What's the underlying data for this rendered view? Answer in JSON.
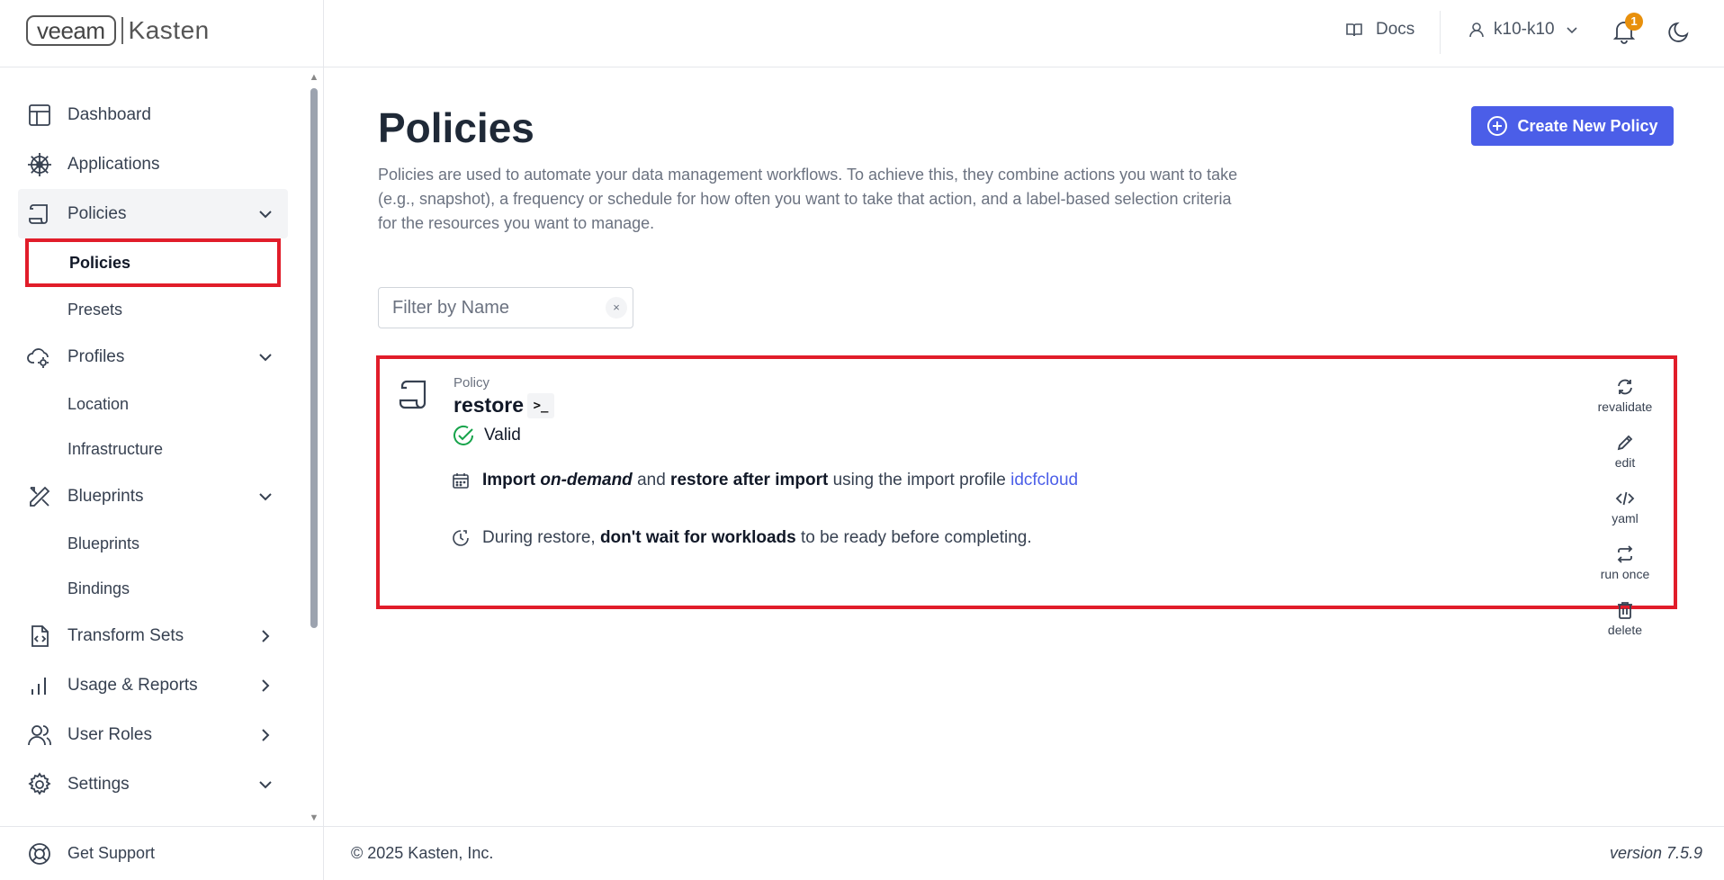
{
  "brand": {
    "logo_left": "veeam",
    "logo_right": "Kasten"
  },
  "topbar": {
    "docs_label": "Docs",
    "user_label": "k10-k10",
    "notification_count": "1"
  },
  "sidebar": {
    "items": [
      {
        "label": "Dashboard",
        "icon": "dashboard-icon"
      },
      {
        "label": "Applications",
        "icon": "helm-wheel-icon"
      },
      {
        "label": "Policies",
        "icon": "scroll-icon",
        "expanded": true,
        "children": [
          {
            "label": "Policies",
            "selected": true
          },
          {
            "label": "Presets"
          }
        ]
      },
      {
        "label": "Profiles",
        "icon": "cloud-gear-icon",
        "expanded": true,
        "children": [
          {
            "label": "Location"
          },
          {
            "label": "Infrastructure"
          }
        ]
      },
      {
        "label": "Blueprints",
        "icon": "pencil-ruler-icon",
        "expanded": true,
        "children": [
          {
            "label": "Blueprints"
          },
          {
            "label": "Bindings"
          }
        ]
      },
      {
        "label": "Transform Sets",
        "icon": "file-code-icon"
      },
      {
        "label": "Usage & Reports",
        "icon": "bar-chart-icon"
      },
      {
        "label": "User Roles",
        "icon": "users-icon"
      },
      {
        "label": "Settings",
        "icon": "gear-icon"
      }
    ],
    "support_label": "Get Support"
  },
  "main": {
    "title": "Policies",
    "create_button": "Create New Policy",
    "description": "Policies are used to automate your data management workflows. To achieve this, they combine actions you want to take (e.g., snapshot), a frequency or schedule for how often you want to take that action, and a label-based selection criteria for the resources you want to manage.",
    "filter_placeholder": "Filter by Name",
    "filter_clear": "×",
    "policy": {
      "kind": "Policy",
      "name": "restore",
      "terminal_label": ">_",
      "status": "Valid",
      "line1": {
        "w1": "Import",
        "w2": "on-demand",
        "w3": "and",
        "w4": "restore after import",
        "w5": "using the import profile",
        "profile": "idcfcloud"
      },
      "line2": {
        "w1": "During restore,",
        "w2": "don't wait for workloads",
        "w3": "to be ready before completing."
      },
      "actions": [
        {
          "label": "revalidate",
          "icon": "refresh-icon"
        },
        {
          "label": "edit",
          "icon": "pencil-icon"
        },
        {
          "label": "yaml",
          "icon": "code-icon"
        },
        {
          "label": "run once",
          "icon": "arrows-exchange-icon"
        },
        {
          "label": "delete",
          "icon": "trash-icon"
        }
      ]
    }
  },
  "footer": {
    "copyright": "© 2025 Kasten, Inc.",
    "version": "version 7.5.9"
  },
  "colors": {
    "accent": "#4b5ee8",
    "highlight": "#e11d2a",
    "valid": "#16a34a",
    "badge": "#e8900c"
  }
}
